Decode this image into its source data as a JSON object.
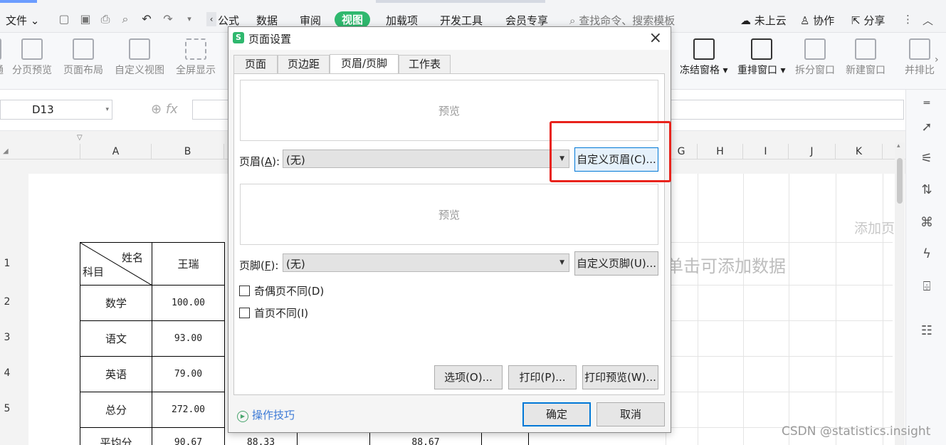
{
  "menu": {
    "file": "文件",
    "tabs": [
      "公式",
      "数据",
      "审阅",
      "视图",
      "加载项",
      "开发工具",
      "会员专享"
    ],
    "active_tab": "视图",
    "search_placeholder": "查找命令、搜索模板",
    "cloud": "未上云",
    "collab": "协作",
    "share": "分享"
  },
  "ribbon": {
    "left_items": [
      "分页预览",
      "页面布局",
      "自定义视图",
      "全屏显示"
    ],
    "left_partial": "通",
    "right_items": [
      "冻结窗格",
      "重排窗口",
      "拆分窗口",
      "新建窗口"
    ],
    "right_partial": "并排比"
  },
  "formula": {
    "cell_ref": "D13",
    "fx": "fx"
  },
  "sheet": {
    "columns": [
      "A",
      "B"
    ],
    "right_columns": [
      "G",
      "H",
      "I",
      "J",
      "K"
    ],
    "rows": [
      "1",
      "2",
      "3",
      "4",
      "5"
    ],
    "table": {
      "header_tr": "姓名",
      "header_bl": "科目",
      "name_col": "王瑞",
      "subjects": [
        "数学",
        "语文",
        "英语",
        "总分",
        "平均分"
      ],
      "values": [
        "100.00",
        "93.00",
        "79.00",
        "272.00",
        "90.67"
      ],
      "extra_row_values": [
        "88.33",
        "88.67"
      ]
    },
    "click_to_add_data": "单击可添加数据",
    "add_header": "添加页"
  },
  "dialog": {
    "title": "页面设置",
    "logo": "S",
    "close": "×",
    "tabs": [
      "页面",
      "页边距",
      "页眉/页脚",
      "工作表"
    ],
    "active_tab": "页眉/页脚",
    "preview": "预览",
    "header_label_pre": "页眉(",
    "header_label_key": "A",
    "header_label_post": "):",
    "header_value": "(无)",
    "custom_header": "自定义页眉(C)...",
    "footer_label_pre": "页脚(",
    "footer_label_key": "F",
    "footer_label_post": "):",
    "footer_value": "(无)",
    "custom_footer": "自定义页脚(U)...",
    "odd_even": "奇偶页不同(D)",
    "first_page": "首页不同(I)",
    "options": "选项(O)...",
    "print": "打印(P)...",
    "print_preview": "打印预览(W)...",
    "tips": "操作技巧",
    "ok": "确定",
    "cancel": "取消"
  },
  "watermark": "CSDN @statistics.insight",
  "colors": {
    "accent_green": "#2fb86e",
    "highlight_red": "#e8231c",
    "focus_blue": "#0078d7"
  }
}
